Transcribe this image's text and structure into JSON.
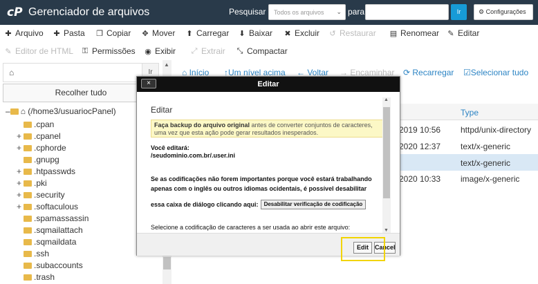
{
  "header": {
    "title": "Gerenciador de arquivos",
    "search_label": "Pesquisar",
    "search_scope": "Todos os arquivos",
    "for_label": "para",
    "go_label": "Ir",
    "settings_label": "Configurações"
  },
  "toolbar": {
    "row1": [
      "Arquivo",
      "Pasta",
      "Copiar",
      "Mover",
      "Carregar",
      "Baixar",
      "Excluir",
      "Restaurar",
      "Renomear",
      "Editar"
    ],
    "row2": [
      "Editor de HTML",
      "Permissões",
      "Exibir",
      "Extrair",
      "Compactar"
    ]
  },
  "sidebar": {
    "home_go": "Ir",
    "collapse_label": "Recolher tudo",
    "root_label": "(/home3/usuariocPanel)",
    "folders": [
      ".cpan",
      ".cpanel",
      ".cphorde",
      ".gnupg",
      ".htpasswds",
      ".pki",
      ".security",
      ".softaculous",
      ".spamassassin",
      ".sqmailattach",
      ".sqmaildata",
      ".ssh",
      ".subaccounts",
      ".trash"
    ]
  },
  "main": {
    "nav": [
      "Início",
      "Um nível acima",
      "Voltar",
      "Encaminhar",
      "Recarregar",
      "Selecionar tudo"
    ],
    "type_header": "Type",
    "rows": [
      {
        "date": "2019 10:56",
        "type": "httpd/unix-directory"
      },
      {
        "date": "2020 12:37",
        "type": "text/x-generic"
      },
      {
        "date": "",
        "type": "text/x-generic"
      },
      {
        "date": "2020 10:33",
        "type": "image/x-generic"
      }
    ]
  },
  "modal": {
    "header": "Editar",
    "close": "×",
    "title": "Editar",
    "warning_bold": "Faça backup do arquivo original",
    "warning_rest": "antes de converter conjuntos de caracteres, uma vez que esta ação pode gerar resultados inesperados.",
    "editing_label": "Você editará:",
    "editing_path": "/seudominio.com.br/.user.ini",
    "para_line1": "Se as codificações não forem importantes porque você estará trabalhando",
    "para_line2": "apenas com o inglês ou outros idiomas ocidentais, é possível desabilitar",
    "para_line3": "essa caixa de diálogo clicando aqui:",
    "disable_button": "Desabilitar verificação de codificação",
    "select_encoding": "Selecione a codificação de caracteres a ser usada ao abrir este arquivo:",
    "edit_button": "Edit",
    "cancel_button": "Cancel"
  },
  "colors": {
    "topbar": "#293a4a",
    "link": "#2c84c4",
    "highlight": "#f2d400"
  }
}
